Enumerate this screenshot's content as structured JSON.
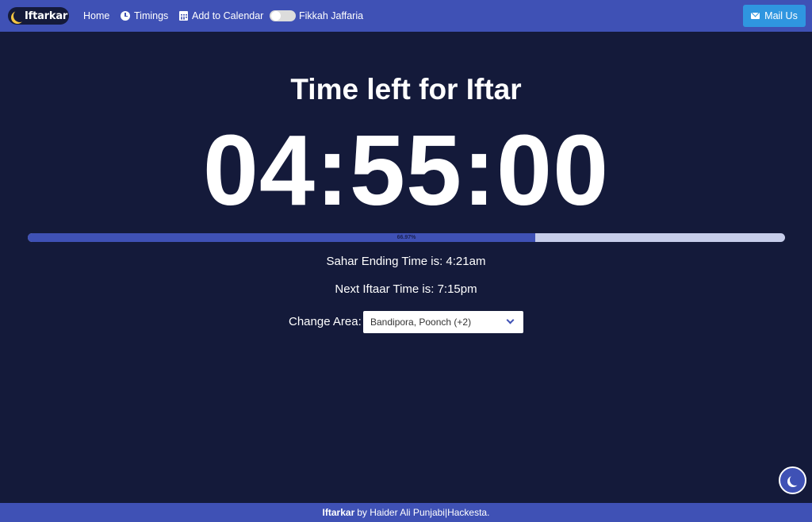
{
  "navbar": {
    "logo_text": "Iftarkar",
    "home_label": "Home",
    "timings_label": "Timings",
    "calendar_label": "Add to Calendar",
    "toggle_label": "Fikkah Jaffaria",
    "toggle_on": false,
    "mail_label": "Mail Us"
  },
  "main": {
    "headline": "Time left for Iftar",
    "countdown": "04:55:00",
    "progress_percent": 66.97,
    "progress_label": "66.97%",
    "sahar_text": "Sahar Ending Time is: 4:21am",
    "iftaar_text": "Next Iftaar Time is: 7:15pm",
    "change_area_label": "Change Area:",
    "area_selected": "Bandipora, Poonch (+2)"
  },
  "footer": {
    "brand": "Iftarkar",
    "credit": "by Haider Ali Punjabi|Hackesta."
  },
  "colors": {
    "accent": "#3f51b5",
    "background": "#141a3a",
    "mail_button": "#2f96e0",
    "progress_track": "#c7cdea"
  }
}
